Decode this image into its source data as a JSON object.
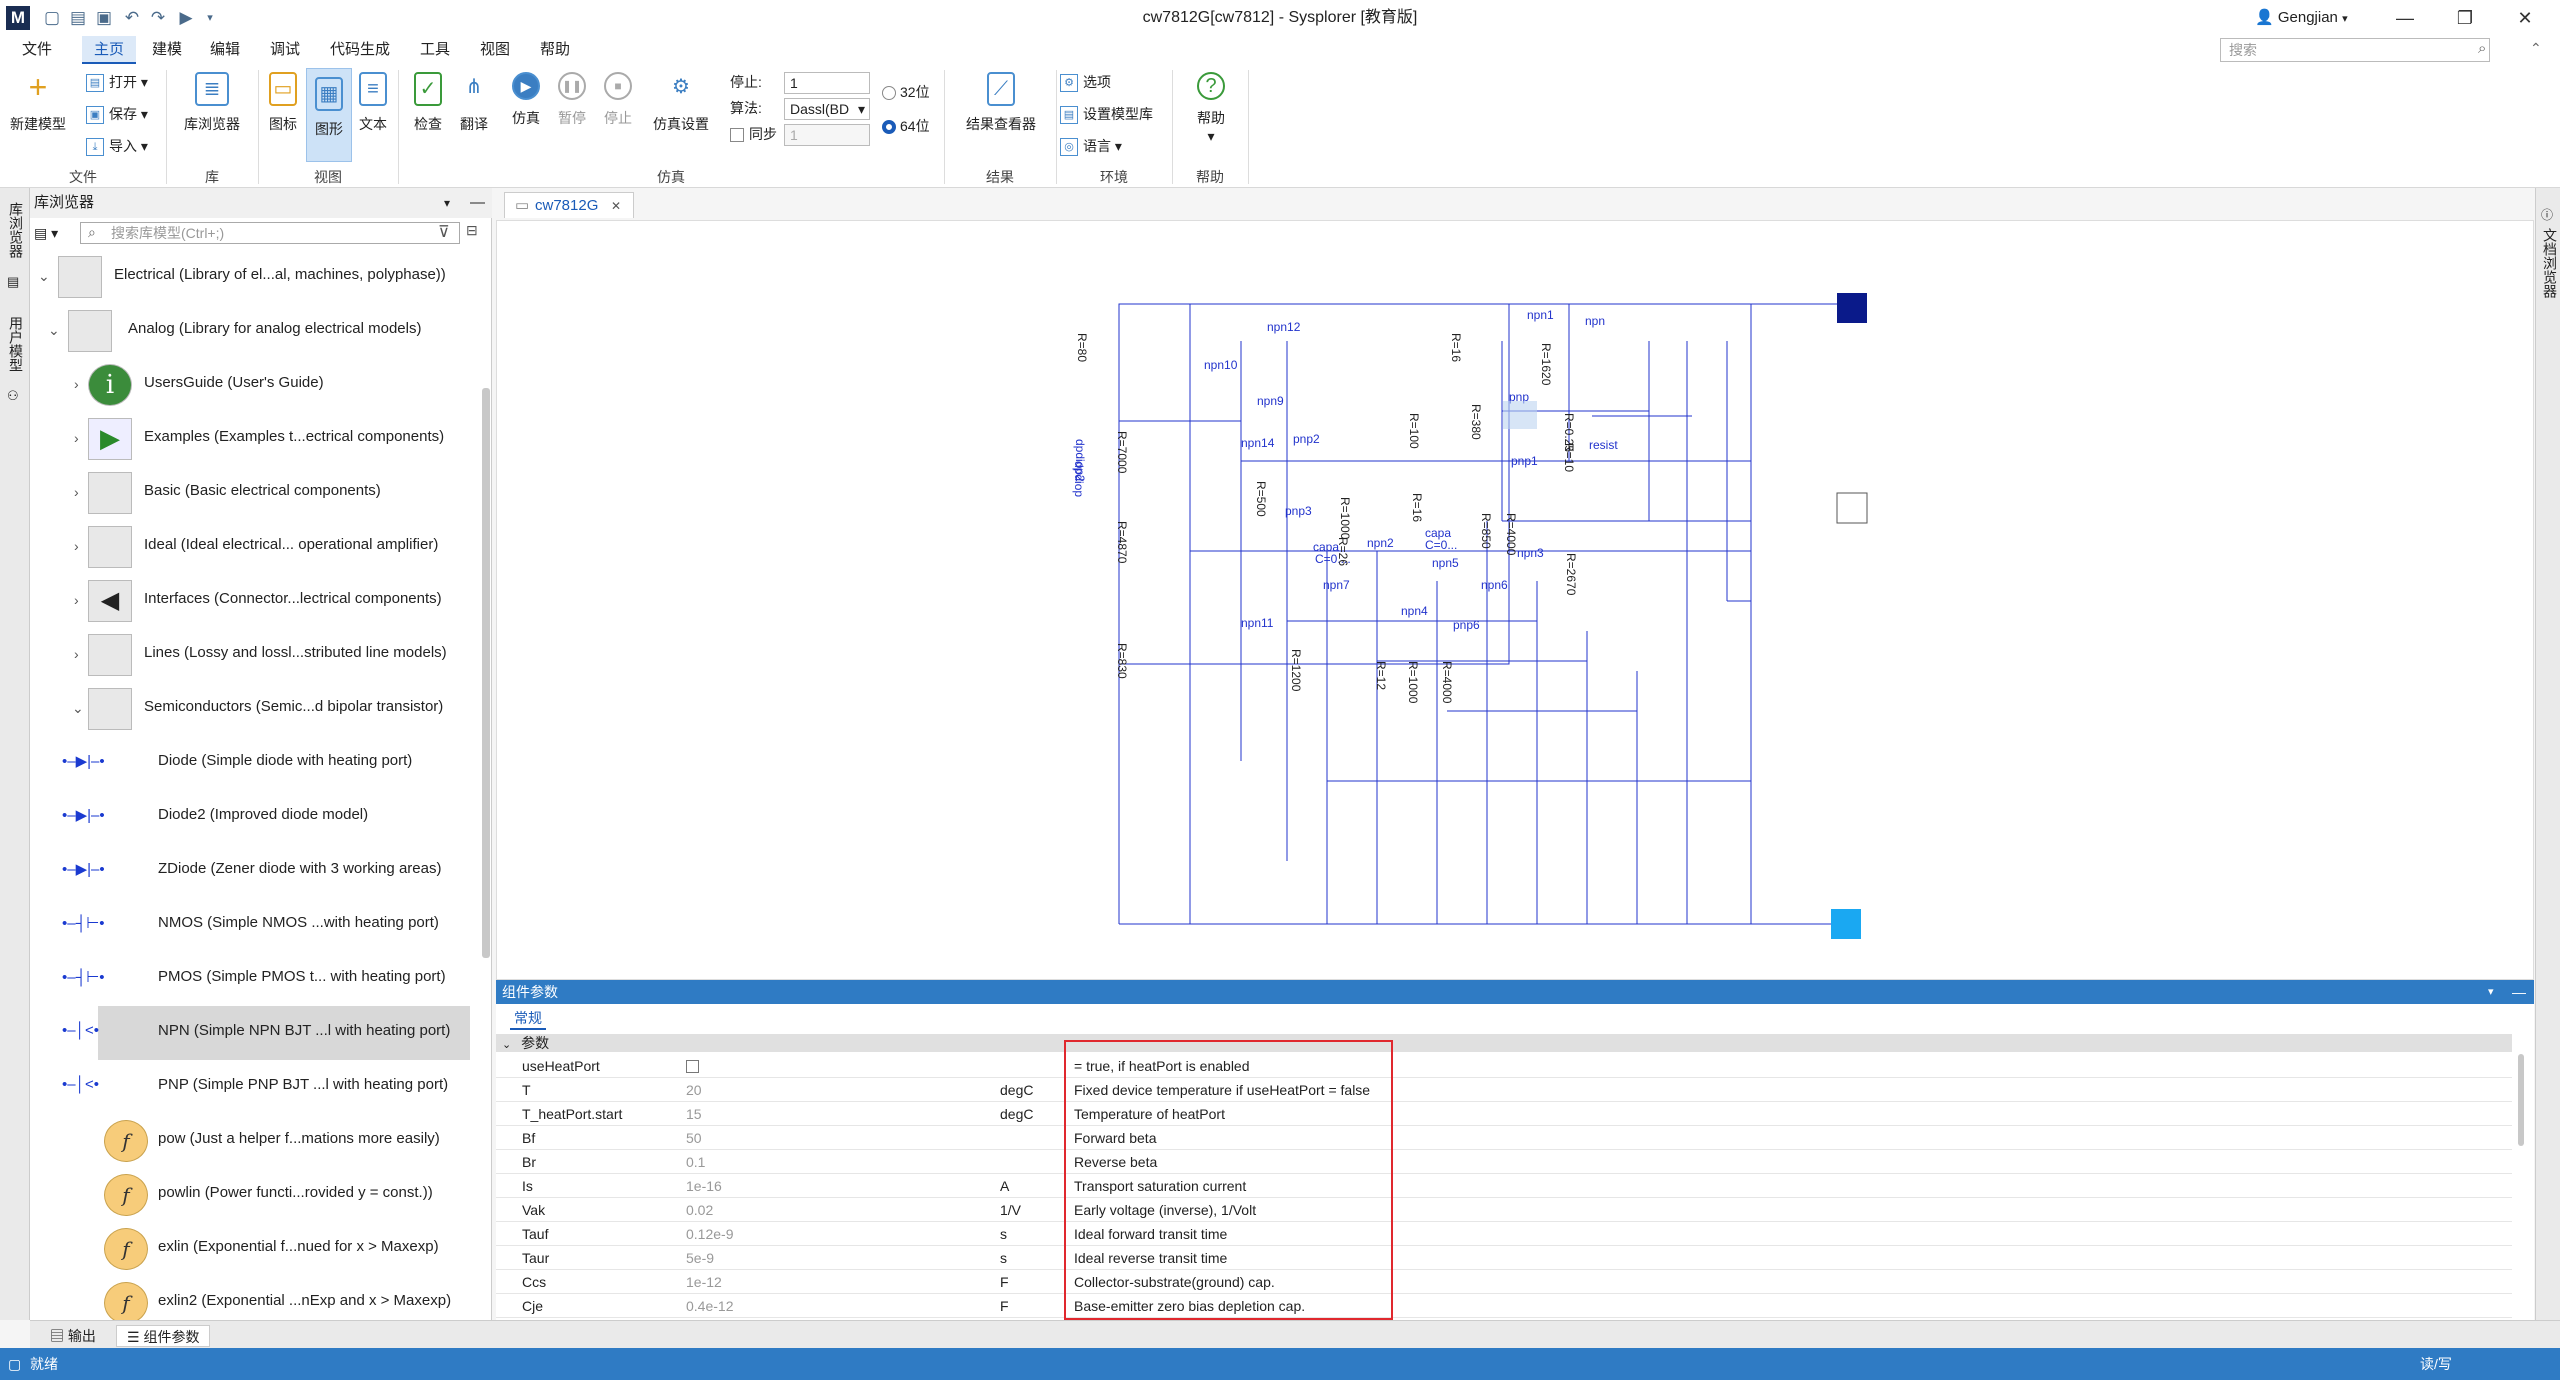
{
  "window": {
    "title": "cw7812G[cw7812] - Sysplorer [教育版]",
    "user": "Gengjian",
    "minimize": "—",
    "maximize": "❐",
    "close": "✕"
  },
  "menu": [
    "文件",
    "主页",
    "建模",
    "编辑",
    "调试",
    "代码生成",
    "工具",
    "视图",
    "帮助"
  ],
  "search": {
    "placeholder": "搜索"
  },
  "ribbon": {
    "new_model": "新建模型",
    "open": "打开",
    "save": "保存",
    "import": "导入",
    "group_file": "文件",
    "lib_browser": "库浏览器",
    "group_lib": "库",
    "icon": "图标",
    "diagram": "图形",
    "text": "文本",
    "group_view": "视图",
    "check": "检查",
    "translate": "翻译",
    "simulate": "仿真",
    "pause": "暂停",
    "stop": "停止",
    "sim_setup": "仿真设置",
    "stop_label": "停止:",
    "stop_value": "1",
    "algo_label": "算法:",
    "algo_value": "Dassl(BD",
    "sync_label": "同步",
    "sync_value": "1",
    "bit32": "32位",
    "bit64": "64位",
    "group_sim": "仿真",
    "result_viewer": "结果查看器",
    "group_result": "结果",
    "options": "选项",
    "set_lib": "设置模型库",
    "language": "语言",
    "group_env": "环境",
    "help": "帮助",
    "group_help": "帮助"
  },
  "left_strip": {
    "tab1": "库浏览器",
    "tab2": "用户模型"
  },
  "right_strip": {
    "tab1": "文档浏览器"
  },
  "library": {
    "title": "库浏览器",
    "search_placeholder": "搜索库模型(Ctrl+;)",
    "items": [
      {
        "label": "Electrical (Library of el...al, machines, polyphase))"
      },
      {
        "label": "Analog (Library for analog electrical models)"
      },
      {
        "label": "UsersGuide (User's Guide)"
      },
      {
        "label": "Examples (Examples t...ectrical components)"
      },
      {
        "label": "Basic (Basic electrical components)"
      },
      {
        "label": "Ideal (Ideal electrical... operational amplifier)"
      },
      {
        "label": "Interfaces (Connector...lectrical components)"
      },
      {
        "label": "Lines (Lossy and lossl...stributed line models)"
      },
      {
        "label": "Semiconductors (Semic...d bipolar transistor)"
      },
      {
        "label": "Diode (Simple diode with heating port)"
      },
      {
        "label": "Diode2 (Improved diode model)"
      },
      {
        "label": "ZDiode (Zener diode with 3 working areas)"
      },
      {
        "label": "NMOS (Simple NMOS ...with heating port)"
      },
      {
        "label": "PMOS (Simple PMOS t... with heating port)"
      },
      {
        "label": "NPN (Simple NPN BJT ...l with heating port)"
      },
      {
        "label": "PNP (Simple PNP BJT ...l with heating port)"
      },
      {
        "label": "pow (Just a helper f...mations more easily)"
      },
      {
        "label": "powlin (Power functi...rovided y = const.))"
      },
      {
        "label": "exlin (Exponential f...nued for x > Maxexp)"
      },
      {
        "label": "exlin2 (Exponential ...nExp and x > Maxexp)"
      }
    ]
  },
  "doc_tab": {
    "label": "cw7812G",
    "close": "✕"
  },
  "circuit": {
    "labels": [
      "npn12",
      "npn1",
      "npn",
      "npn10",
      "npn9",
      "pnp",
      "npn14",
      "pnp2",
      "pnp1",
      "pnp3",
      "npn2",
      "capa",
      "capa",
      "C=0....",
      "C=0...",
      "npn5",
      "npn3",
      "npn7",
      "npn6",
      "npn4",
      "pnp6",
      "npn11",
      "R=80",
      "R=16",
      "R=1620",
      "R=380",
      "R=100",
      "R=7000",
      "R=0.25",
      "R=10",
      "R=500",
      "R=1000",
      "R=26",
      "R=16",
      "R=850",
      "R=4000",
      "R=4870",
      "R=2670",
      "R=830",
      "R=1200",
      "R=12",
      "R=1000",
      "R=4000",
      "dpdiop",
      "dpdiop2",
      "resist"
    ]
  },
  "params": {
    "panel_title": "组件参数",
    "tab": "常规",
    "section": "参数",
    "rows": [
      {
        "name": "useHeatPort",
        "value": "",
        "unit": "",
        "desc": "= true, if heatPort is enabled"
      },
      {
        "name": "T",
        "value": "20",
        "unit": "degC",
        "desc": "Fixed device temperature if useHeatPort = false"
      },
      {
        "name": "T_heatPort.start",
        "value": "15",
        "unit": "degC",
        "desc": "Temperature of heatPort"
      },
      {
        "name": "Bf",
        "value": "50",
        "unit": "",
        "desc": "Forward beta"
      },
      {
        "name": "Br",
        "value": "0.1",
        "unit": "",
        "desc": "Reverse beta"
      },
      {
        "name": "Is",
        "value": "1e-16",
        "unit": "A",
        "desc": "Transport saturation current"
      },
      {
        "name": "Vak",
        "value": "0.02",
        "unit": "1/V",
        "desc": "Early voltage (inverse), 1/Volt"
      },
      {
        "name": "Tauf",
        "value": "0.12e-9",
        "unit": "s",
        "desc": "Ideal forward transit time"
      },
      {
        "name": "Taur",
        "value": "5e-9",
        "unit": "s",
        "desc": "Ideal reverse transit time"
      },
      {
        "name": "Ccs",
        "value": "1e-12",
        "unit": "F",
        "desc": "Collector-substrate(ground) cap."
      },
      {
        "name": "Cje",
        "value": "0.4e-12",
        "unit": "F",
        "desc": "Base-emitter zero bias depletion cap."
      }
    ]
  },
  "bottom_tabs": {
    "output": "输出",
    "params": "组件参数"
  },
  "status": {
    "left": "就绪",
    "right": "读/写"
  },
  "colors": {
    "accent": "#2f7bc4",
    "wire": "#2233cc",
    "highlight_box": "#e0282e"
  }
}
